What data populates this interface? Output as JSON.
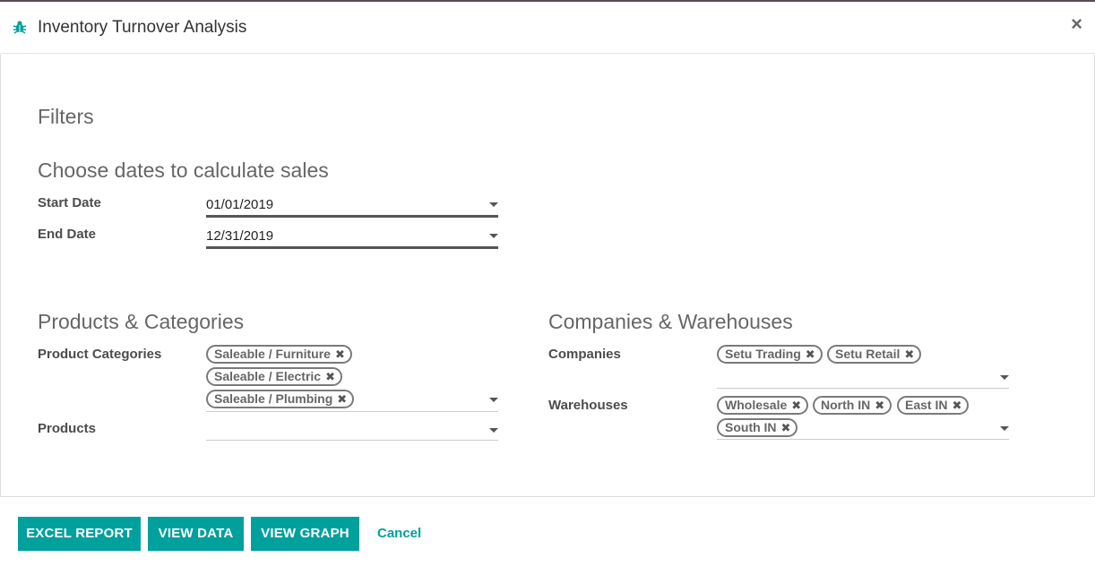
{
  "dialog": {
    "title": "Inventory Turnover Analysis",
    "close_label": "×"
  },
  "filters": {
    "heading": "Filters",
    "dates": {
      "heading": "Choose dates to calculate sales",
      "start_label": "Start Date",
      "start_value": "01/01/2019",
      "end_label": "End Date",
      "end_value": "12/31/2019"
    },
    "products": {
      "heading": "Products & Categories",
      "categories_label": "Product Categories",
      "categories": [
        "Saleable / Furniture",
        "Saleable / Electric",
        "Saleable / Plumbing"
      ],
      "products_label": "Products"
    },
    "companies": {
      "heading": "Companies & Warehouses",
      "companies_label": "Companies",
      "companies": [
        "Setu Trading",
        "Setu Retail"
      ],
      "warehouses_label": "Warehouses",
      "warehouses": [
        "Wholesale",
        "North IN",
        "East IN",
        "South IN"
      ]
    }
  },
  "footer": {
    "excel_label": "EXCEL REPORT",
    "view_data_label": "VIEW DATA",
    "view_graph_label": "VIEW GRAPH",
    "cancel_label": "Cancel"
  },
  "colors": {
    "accent": "#00a09d",
    "tag_border": "#7a7a7a"
  },
  "icons": {
    "title_icon": "bug-icon",
    "close": "close-icon",
    "dropdown": "caret-down-icon",
    "tag_remove": "remove-tag-icon"
  }
}
